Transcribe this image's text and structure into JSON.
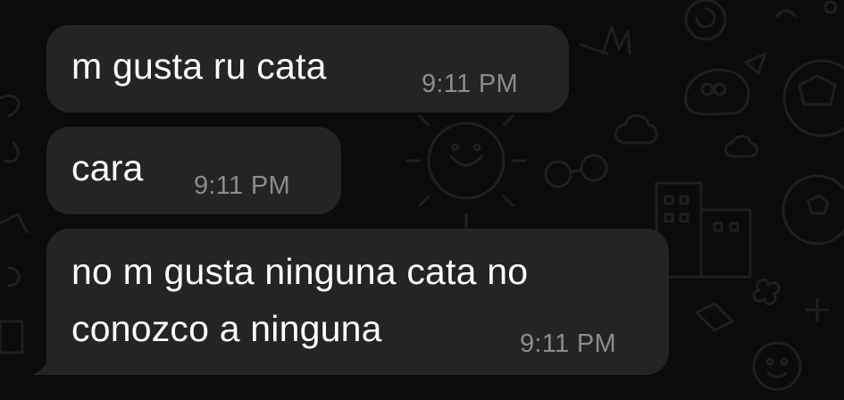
{
  "chat": {
    "messages": [
      {
        "lines": [
          "m gusta ru cata"
        ],
        "time": "9:11 PM"
      },
      {
        "lines": [
          "cara"
        ],
        "time": "9:11 PM"
      },
      {
        "lines": [
          "no m gusta ninguna cata no",
          "conozco a ninguna"
        ],
        "time": "9:11 PM"
      }
    ]
  },
  "colors": {
    "background": "#0b0b0b",
    "bubble": "#232424",
    "text": "#ffffff",
    "timestamp": "#8c8c8c"
  }
}
